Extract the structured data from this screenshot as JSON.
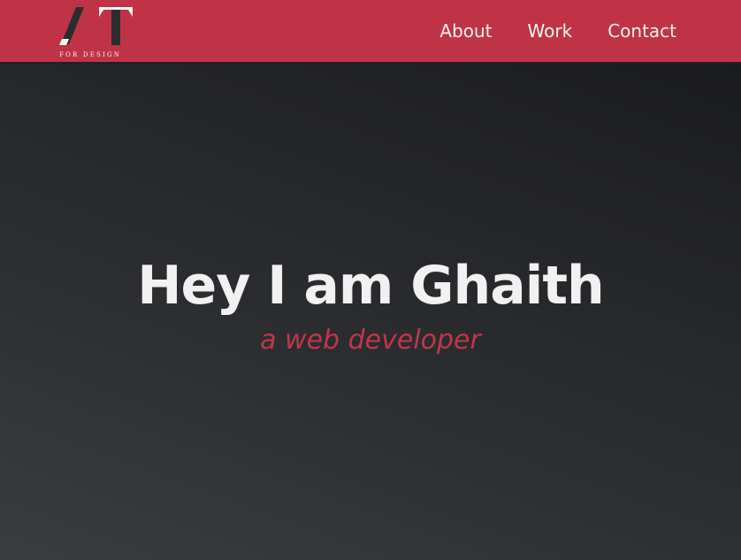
{
  "brand": {
    "logo_letters": "AT",
    "logo_tagline": "FOR DESIGN",
    "color": "#c03347"
  },
  "nav": {
    "items": [
      {
        "label": "About"
      },
      {
        "label": "Work"
      },
      {
        "label": "Contact"
      }
    ]
  },
  "hero": {
    "title": "Hey I am Ghaith",
    "subtitle": "a web developer",
    "accent_color": "#c0364a"
  }
}
